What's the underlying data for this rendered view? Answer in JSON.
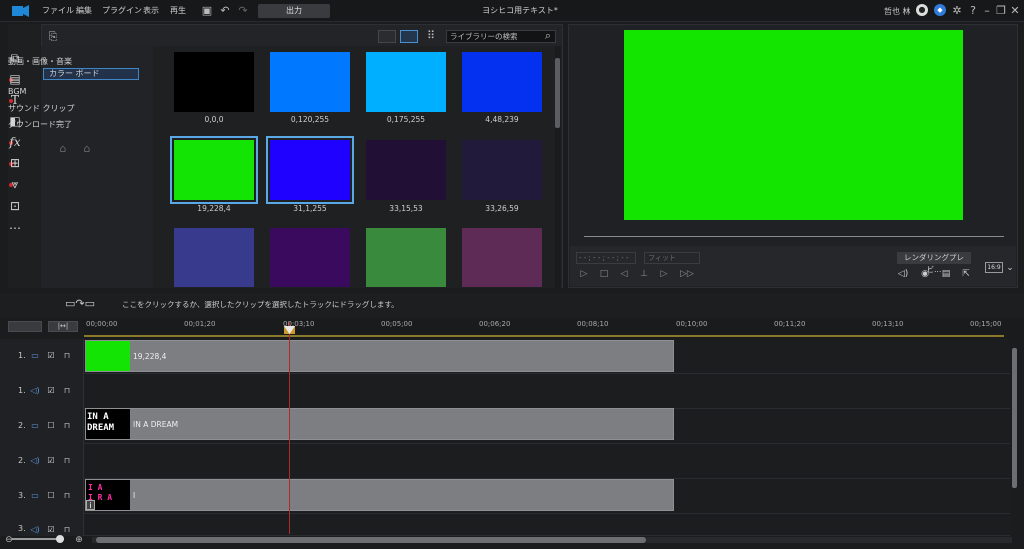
{
  "titlebar": {
    "menu": [
      "ファイル",
      "編集",
      "プラグイン",
      "表示",
      "再生"
    ],
    "export_label": "出力",
    "window_title": "ヨシヒコ用テキスト*",
    "user_name": "哲也 林"
  },
  "library": {
    "tree": [
      "動画・画像・音楽",
      "カラー ボード",
      "BGM",
      "サウンド クリップ",
      "ダウンロード完了"
    ],
    "search_placeholder": "ライブラリーの検索",
    "swatches": [
      {
        "label": "0,0,0",
        "color": "#000000"
      },
      {
        "label": "0,120,255",
        "color": "#0078ff"
      },
      {
        "label": "0,175,255",
        "color": "#00afff"
      },
      {
        "label": "4,48,239",
        "color": "#0430ef"
      },
      {
        "label": "19,228,4",
        "color": "#13e404"
      },
      {
        "label": "31,1,255",
        "color": "#1f01ff"
      },
      {
        "label": "33,15,53",
        "color": "#210f35"
      },
      {
        "label": "33,26,59",
        "color": "#211a3b"
      },
      {
        "label": "",
        "color": "#383a8e"
      },
      {
        "label": "",
        "color": "#3a0a5e"
      },
      {
        "label": "",
        "color": "#3a8a3e"
      },
      {
        "label": "",
        "color": "#5e2a56"
      }
    ]
  },
  "preview": {
    "screen_color": "#13e400",
    "timecode": "- - ; - - ; - - ; - -",
    "fit": "フィット",
    "render_preview": "レンダリングプレビ...",
    "aspect": "16:9"
  },
  "toolstrip": {
    "hint": "ここをクリックするか、選択したクリップを選択したトラックにドラッグします。"
  },
  "timeline": {
    "ticks": [
      "00;00;00",
      "00;01;20",
      "00;03;10",
      "00;05;00",
      "00;06;20",
      "00;08;10",
      "00;10;00",
      "00;11;20",
      "00;13;10",
      "00;15;00"
    ],
    "tracks": [
      {
        "num": "1.",
        "type": "video",
        "clip": "19,228,4"
      },
      {
        "num": "1.",
        "type": "audio",
        "clip": ""
      },
      {
        "num": "2.",
        "type": "video",
        "clip": "IN A DREAM"
      },
      {
        "num": "2.",
        "type": "audio",
        "clip": ""
      },
      {
        "num": "3.",
        "type": "video",
        "clip": "I"
      },
      {
        "num": "3.",
        "type": "audio",
        "clip": ""
      }
    ],
    "thumb_text_line1": "IN A",
    "thumb_text_line2": "DREAM",
    "thumb3_line1": "I  A",
    "thumb3_line2": "I  R  A",
    "thumb3_glyph": "i"
  }
}
